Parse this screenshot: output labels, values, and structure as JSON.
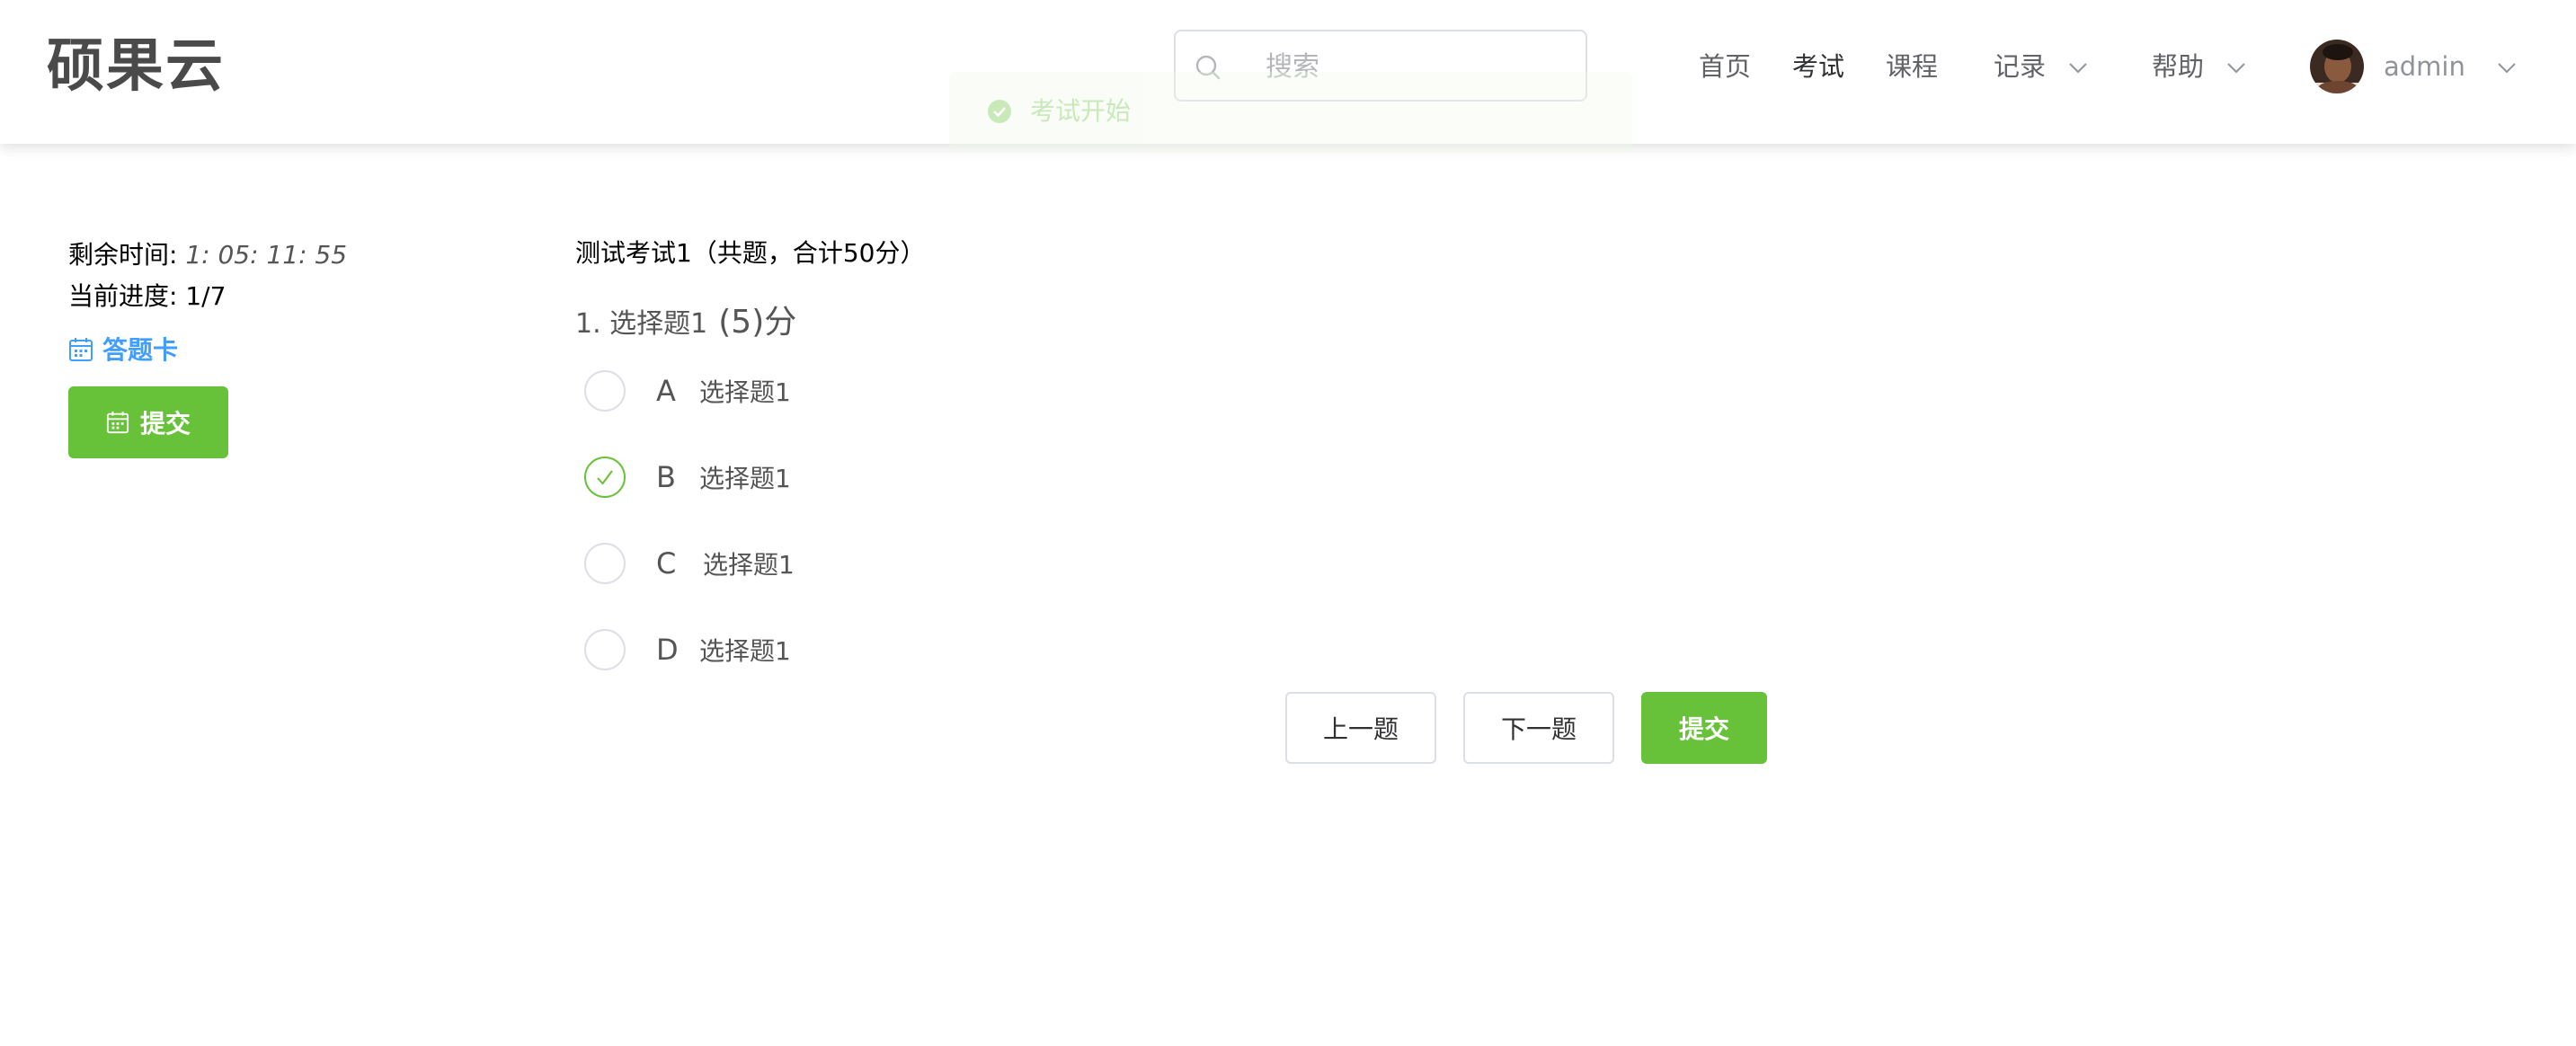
{
  "header": {
    "logo": "硕果云",
    "search_placeholder": "搜索",
    "nav": [
      {
        "label": "首页",
        "active": false
      },
      {
        "label": "考试",
        "active": true
      },
      {
        "label": "课程",
        "active": false
      },
      {
        "label": "记录",
        "dropdown": true
      },
      {
        "label": "帮助",
        "dropdown": true
      }
    ],
    "user": {
      "name": "admin"
    }
  },
  "toast": {
    "message": "考试开始",
    "type": "success"
  },
  "sidebar": {
    "time_label": "剩余时间:",
    "time_value": "1: 05: 11: 55",
    "progress_label": "当前进度:",
    "progress_value": "1/7",
    "answer_card": "答题卡",
    "submit": "提交"
  },
  "exam": {
    "title": "测试考试1（共题，合计50分）",
    "question": {
      "number_title": "1. 选择题1",
      "score": "(5)分",
      "options": [
        {
          "letter": "A",
          "text": "选择题1",
          "checked": false
        },
        {
          "letter": "B",
          "text": "选择题1",
          "checked": true
        },
        {
          "letter": "C",
          "text": "选择题1",
          "checked": false
        },
        {
          "letter": "D",
          "text": "选择题1",
          "checked": false
        }
      ]
    },
    "buttons": {
      "prev": "上一题",
      "next": "下一题",
      "submit": "提交"
    }
  },
  "colors": {
    "primary_green": "#67c23a",
    "link_blue": "#409eff",
    "border": "#dcdfe6"
  }
}
